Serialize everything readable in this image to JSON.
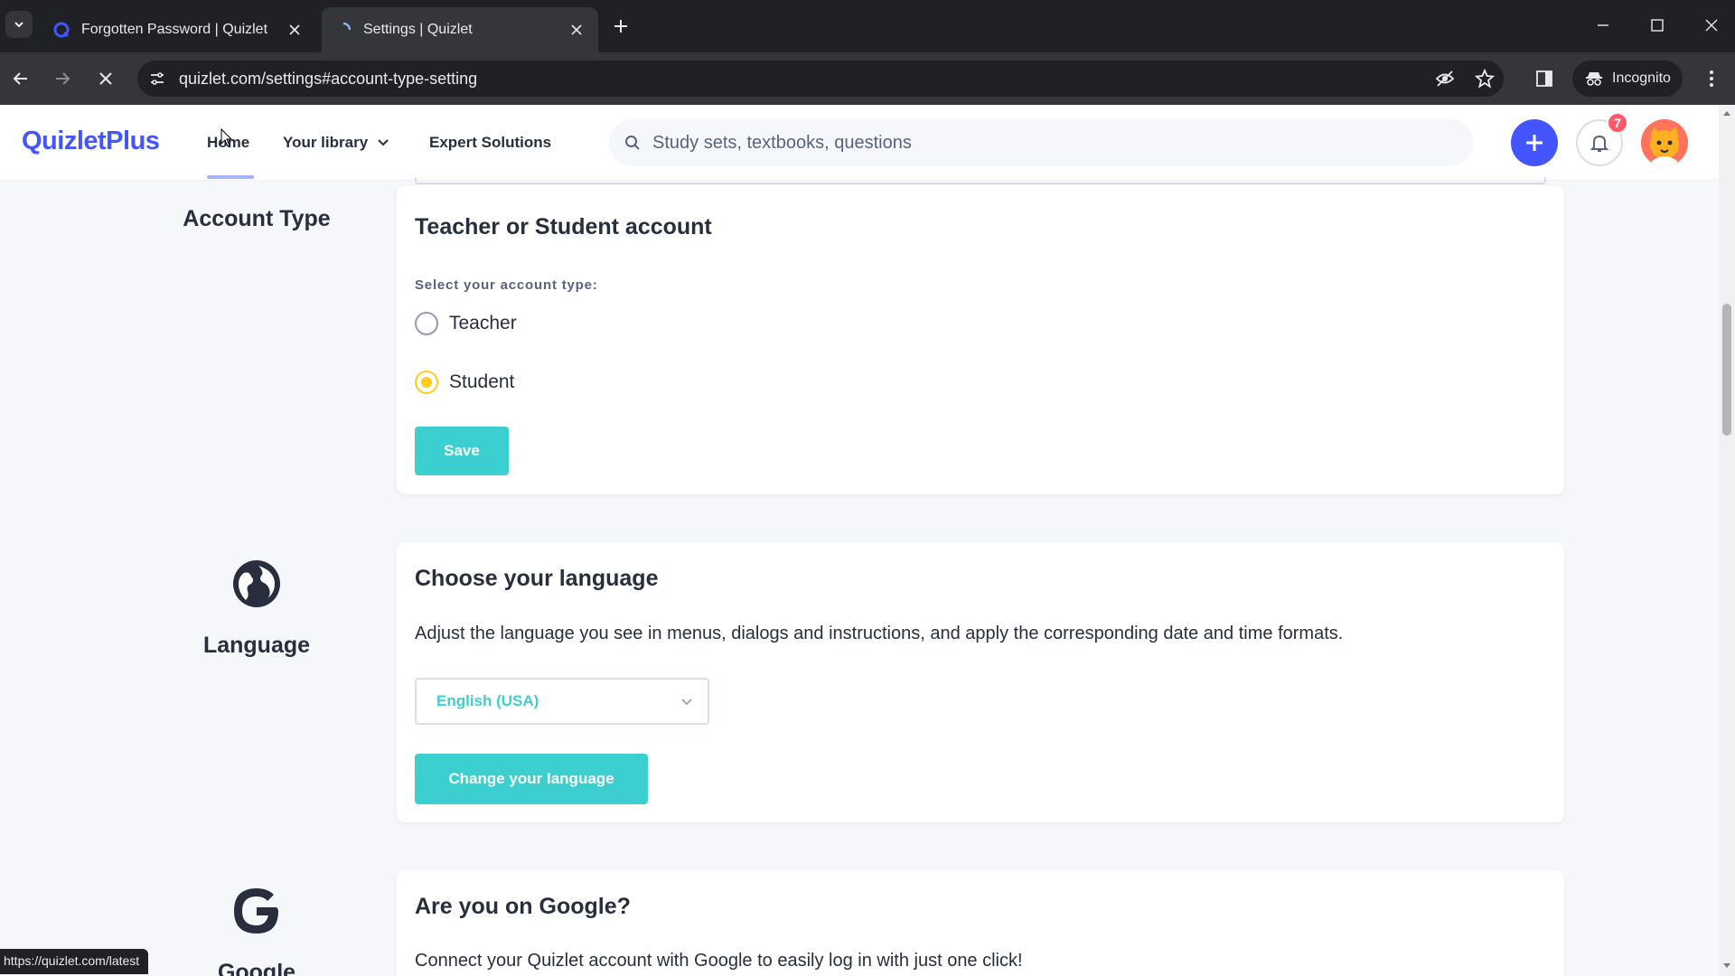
{
  "browser": {
    "tabs": [
      {
        "title": "Forgotten Password | Quizlet",
        "active": false
      },
      {
        "title": "Settings | Quizlet",
        "active": true
      }
    ],
    "url": "quizlet.com/settings#account-type-setting",
    "incognito_label": "Incognito",
    "status_url": "https://quizlet.com/latest"
  },
  "header": {
    "logo": "QuizletPlus",
    "nav": {
      "home": "Home",
      "library": "Your library",
      "expert": "Expert Solutions"
    },
    "search_placeholder": "Study sets, textbooks, questions",
    "notification_count": "7"
  },
  "account_type": {
    "side_label": "Account Type",
    "title": "Teacher or Student account",
    "select_label": "Select your account type:",
    "options": [
      {
        "label": "Teacher",
        "selected": false
      },
      {
        "label": "Student",
        "selected": true
      }
    ],
    "save_label": "Save"
  },
  "language": {
    "side_label": "Language",
    "title": "Choose your language",
    "description": "Adjust the language you see in menus, dialogs and instructions, and apply the corresponding date and time formats.",
    "selected": "English (USA)",
    "button_label": "Change your language"
  },
  "google": {
    "side_label": "Google",
    "title": "Are you on Google?",
    "description": "Connect your Quizlet account with Google to easily log in with just one click!"
  },
  "colors": {
    "brand": "#4255ff",
    "teal": "#3ccfcf",
    "radio_selected": "#ffcd1f",
    "badge": "#ff5a6a"
  }
}
